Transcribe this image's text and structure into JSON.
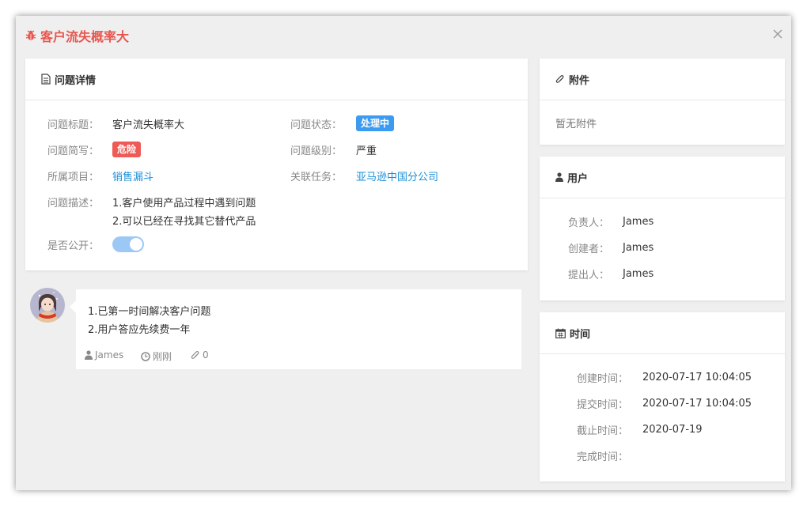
{
  "dialog": {
    "title": "客户流失概率大",
    "close_icon": "close-icon"
  },
  "details": {
    "heading": "问题详情",
    "title_label": "问题标题：",
    "title_value": "客户流失概率大",
    "status_label": "问题状态：",
    "status_value": "处理中",
    "short_label": "问题简写：",
    "short_value": "危险",
    "level_label": "问题级别：",
    "level_value": "严重",
    "project_label": "所属项目：",
    "project_value": "销售漏斗",
    "task_label": "关联任务：",
    "task_value": "亚马逊中国分公司",
    "desc_label": "问题描述：",
    "desc_lines": [
      "1.客户使用产品过程中遇到问题",
      "2.可以已经在寻找其它替代产品"
    ],
    "public_label": "是否公开：",
    "public_value": true
  },
  "comment": {
    "lines": [
      "1.已第一时间解决客户问题",
      "2.用户答应先续费一年"
    ],
    "author": "James",
    "time": "刚刚",
    "attachments": "0"
  },
  "attachments": {
    "heading": "附件",
    "empty_text": "暂无附件"
  },
  "users": {
    "heading": "用户",
    "owner_label": "负责人：",
    "owner": "James",
    "creator_label": "创建者：",
    "creator": "James",
    "reporter_label": "提出人：",
    "reporter": "James"
  },
  "time": {
    "heading": "时间",
    "created_label": "创建时间：",
    "created": "2020-07-17 10:04:05",
    "submitted_label": "提交时间：",
    "submitted": "2020-07-17 10:04:05",
    "deadline_label": "截止时间：",
    "deadline": "2020-07-19",
    "completed_label": "完成时间：",
    "completed": ""
  },
  "colors": {
    "title_red": "#e8564f",
    "badge_blue": "#3a9bf0",
    "badge_red": "#ee5a55",
    "link_blue": "#1c8fd6",
    "toggle_on": "#9cc8f6"
  }
}
